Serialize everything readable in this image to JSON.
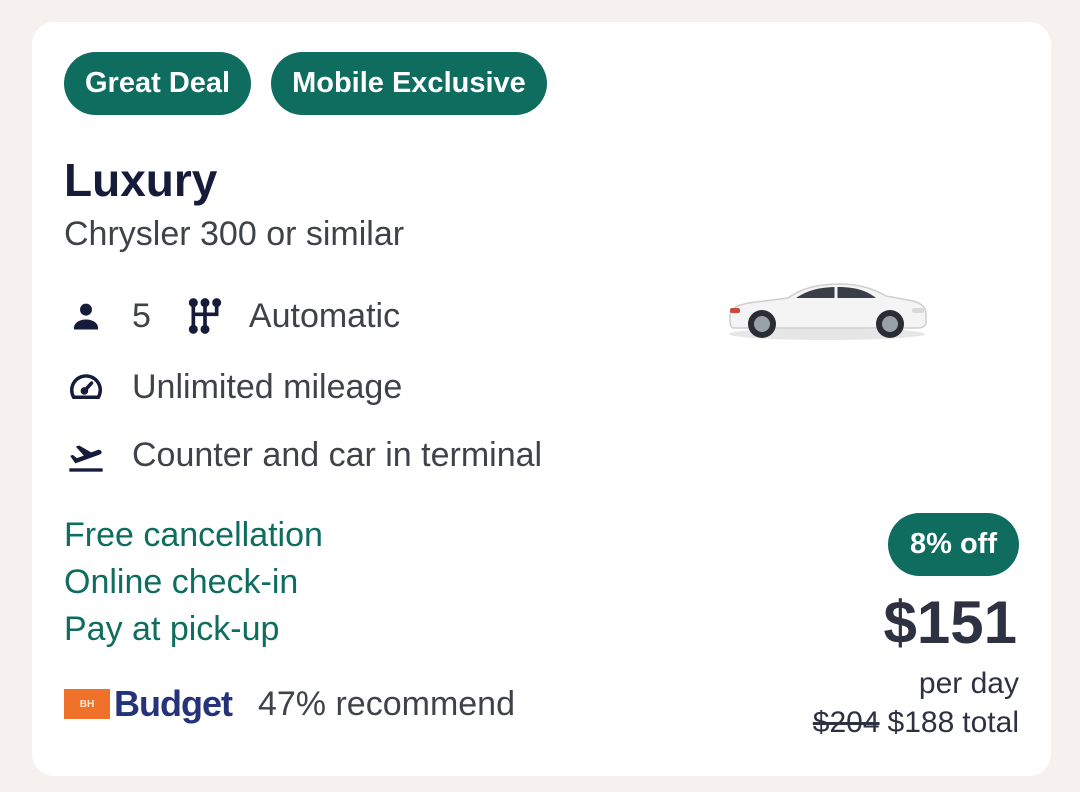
{
  "badges": [
    "Great Deal",
    "Mobile Exclusive"
  ],
  "car": {
    "category": "Luxury",
    "model": "Chrysler 300 or similar",
    "seats": "5",
    "transmission": "Automatic",
    "mileage": "Unlimited mileage",
    "location": "Counter and car in terminal"
  },
  "perks": [
    "Free cancellation",
    "Online check-in",
    "Pay at pick-up"
  ],
  "vendor": {
    "logo_text": "Budget",
    "logo_box_text": "BH",
    "recommend": "47% recommend"
  },
  "pricing": {
    "discount": "8% off",
    "price": "$151",
    "per": "per day",
    "old_total": "$204",
    "new_total": "$188",
    "total_label": "total"
  },
  "colors": {
    "accent": "#0e6d5f",
    "title": "#161b3a",
    "text": "#3f4249",
    "logo_orange": "#f0712a",
    "logo_blue": "#24337a"
  },
  "icons": [
    "person-icon",
    "gear-shift-icon",
    "speedometer-icon",
    "airplane-departure-icon",
    "car-image"
  ]
}
